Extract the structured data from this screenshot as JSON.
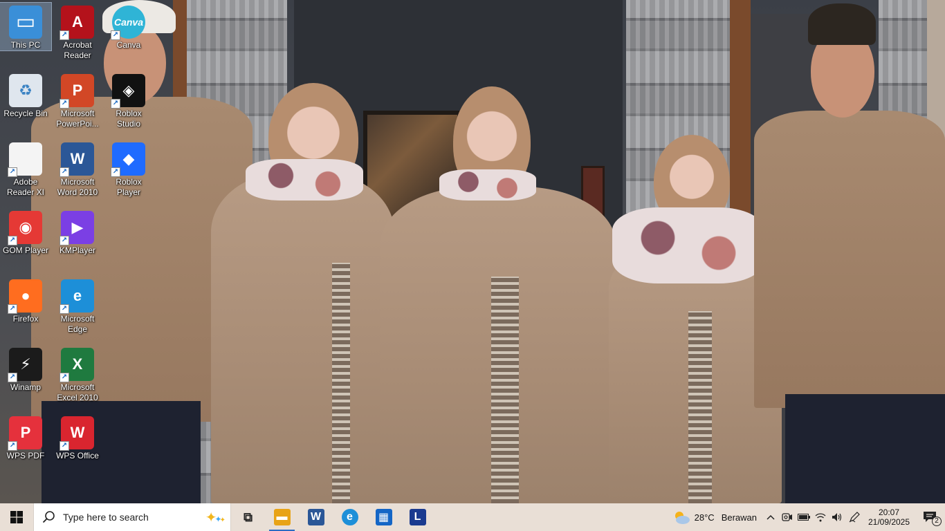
{
  "desktop": {
    "icons": [
      {
        "label": "This PC",
        "icon": "this-pc-icon",
        "color": "#3a8fd8",
        "glyph": "▭",
        "shortcut": false,
        "selected": true
      },
      {
        "label": "Acrobat\nReader",
        "icon": "acrobat-reader-icon",
        "color": "#b4121b",
        "glyph": "A",
        "shortcut": true
      },
      {
        "label": "Canva",
        "icon": "canva-icon",
        "color": "#2fb4d6",
        "glyph": "Canva",
        "shortcut": true
      },
      {
        "label": "Recycle Bin",
        "icon": "recycle-bin-icon",
        "color": "#dfe6ee",
        "glyph": "♻",
        "shortcut": false
      },
      {
        "label": "Microsoft\nPowerPoi...",
        "icon": "powerpoint-icon",
        "color": "#d24726",
        "glyph": "P",
        "shortcut": true
      },
      {
        "label": "Roblox\nStudio",
        "icon": "roblox-studio-icon",
        "color": "#111111",
        "glyph": "◈",
        "shortcut": true
      },
      {
        "label": "Adobe\nReader XI",
        "icon": "adobe-reader-icon",
        "color": "#f4f4f4",
        "glyph": "",
        "shortcut": true
      },
      {
        "label": "Microsoft\nWord 2010",
        "icon": "word-icon",
        "color": "#2b5797",
        "glyph": "W",
        "shortcut": true
      },
      {
        "label": "Roblox\nPlayer",
        "icon": "roblox-player-icon",
        "color": "#1f6bff",
        "glyph": "◆",
        "shortcut": true
      },
      {
        "label": "GOM Player",
        "icon": "gom-player-icon",
        "color": "#e53935",
        "glyph": "◉",
        "shortcut": true
      },
      {
        "label": "KMPlayer",
        "icon": "kmplayer-icon",
        "color": "#7b3fe4",
        "glyph": "▶",
        "shortcut": true
      },
      {
        "label": "Firefox",
        "icon": "firefox-icon",
        "color": "#ff6d1f",
        "glyph": "●",
        "shortcut": true
      },
      {
        "label": "Microsoft\nEdge",
        "icon": "edge-icon",
        "color": "#1d8fd8",
        "glyph": "e",
        "shortcut": true
      },
      {
        "label": "Winamp",
        "icon": "winamp-icon",
        "color": "#1b1b1b",
        "glyph": "⚡",
        "shortcut": true
      },
      {
        "label": "Microsoft\nExcel 2010",
        "icon": "excel-icon",
        "color": "#1f7a3f",
        "glyph": "X",
        "shortcut": true
      },
      {
        "label": "WPS PDF",
        "icon": "wps-pdf-icon",
        "color": "#e5313c",
        "glyph": "P",
        "shortcut": true
      },
      {
        "label": "WPS Office",
        "icon": "wps-office-icon",
        "color": "#d9252f",
        "glyph": "W",
        "shortcut": true
      }
    ]
  },
  "taskbar": {
    "search_placeholder": "Type here to search",
    "pinned": [
      {
        "name": "task-view",
        "icon": "task-view-icon",
        "glyph": "⧉",
        "color": "#222222",
        "active": false
      },
      {
        "name": "file-explorer",
        "icon": "folder-icon",
        "glyph": "▬",
        "color": "#e8a317",
        "active": true
      },
      {
        "name": "word",
        "icon": "word-icon",
        "glyph": "W",
        "color": "#2b5797",
        "active": false
      },
      {
        "name": "edge",
        "icon": "edge-icon",
        "glyph": "e",
        "color": "#1d8fd8",
        "active": false
      },
      {
        "name": "store",
        "icon": "store-icon",
        "glyph": "▦",
        "color": "#1466c6",
        "active": false
      },
      {
        "name": "l-app",
        "icon": "l-app-icon",
        "glyph": "L",
        "color": "#1a3a8f",
        "active": false
      }
    ],
    "weather": {
      "temp": "28°C",
      "condition": "Berawan"
    },
    "clock": {
      "time": "20:07",
      "date": "21/09/2025"
    },
    "notifications_count": "2"
  }
}
